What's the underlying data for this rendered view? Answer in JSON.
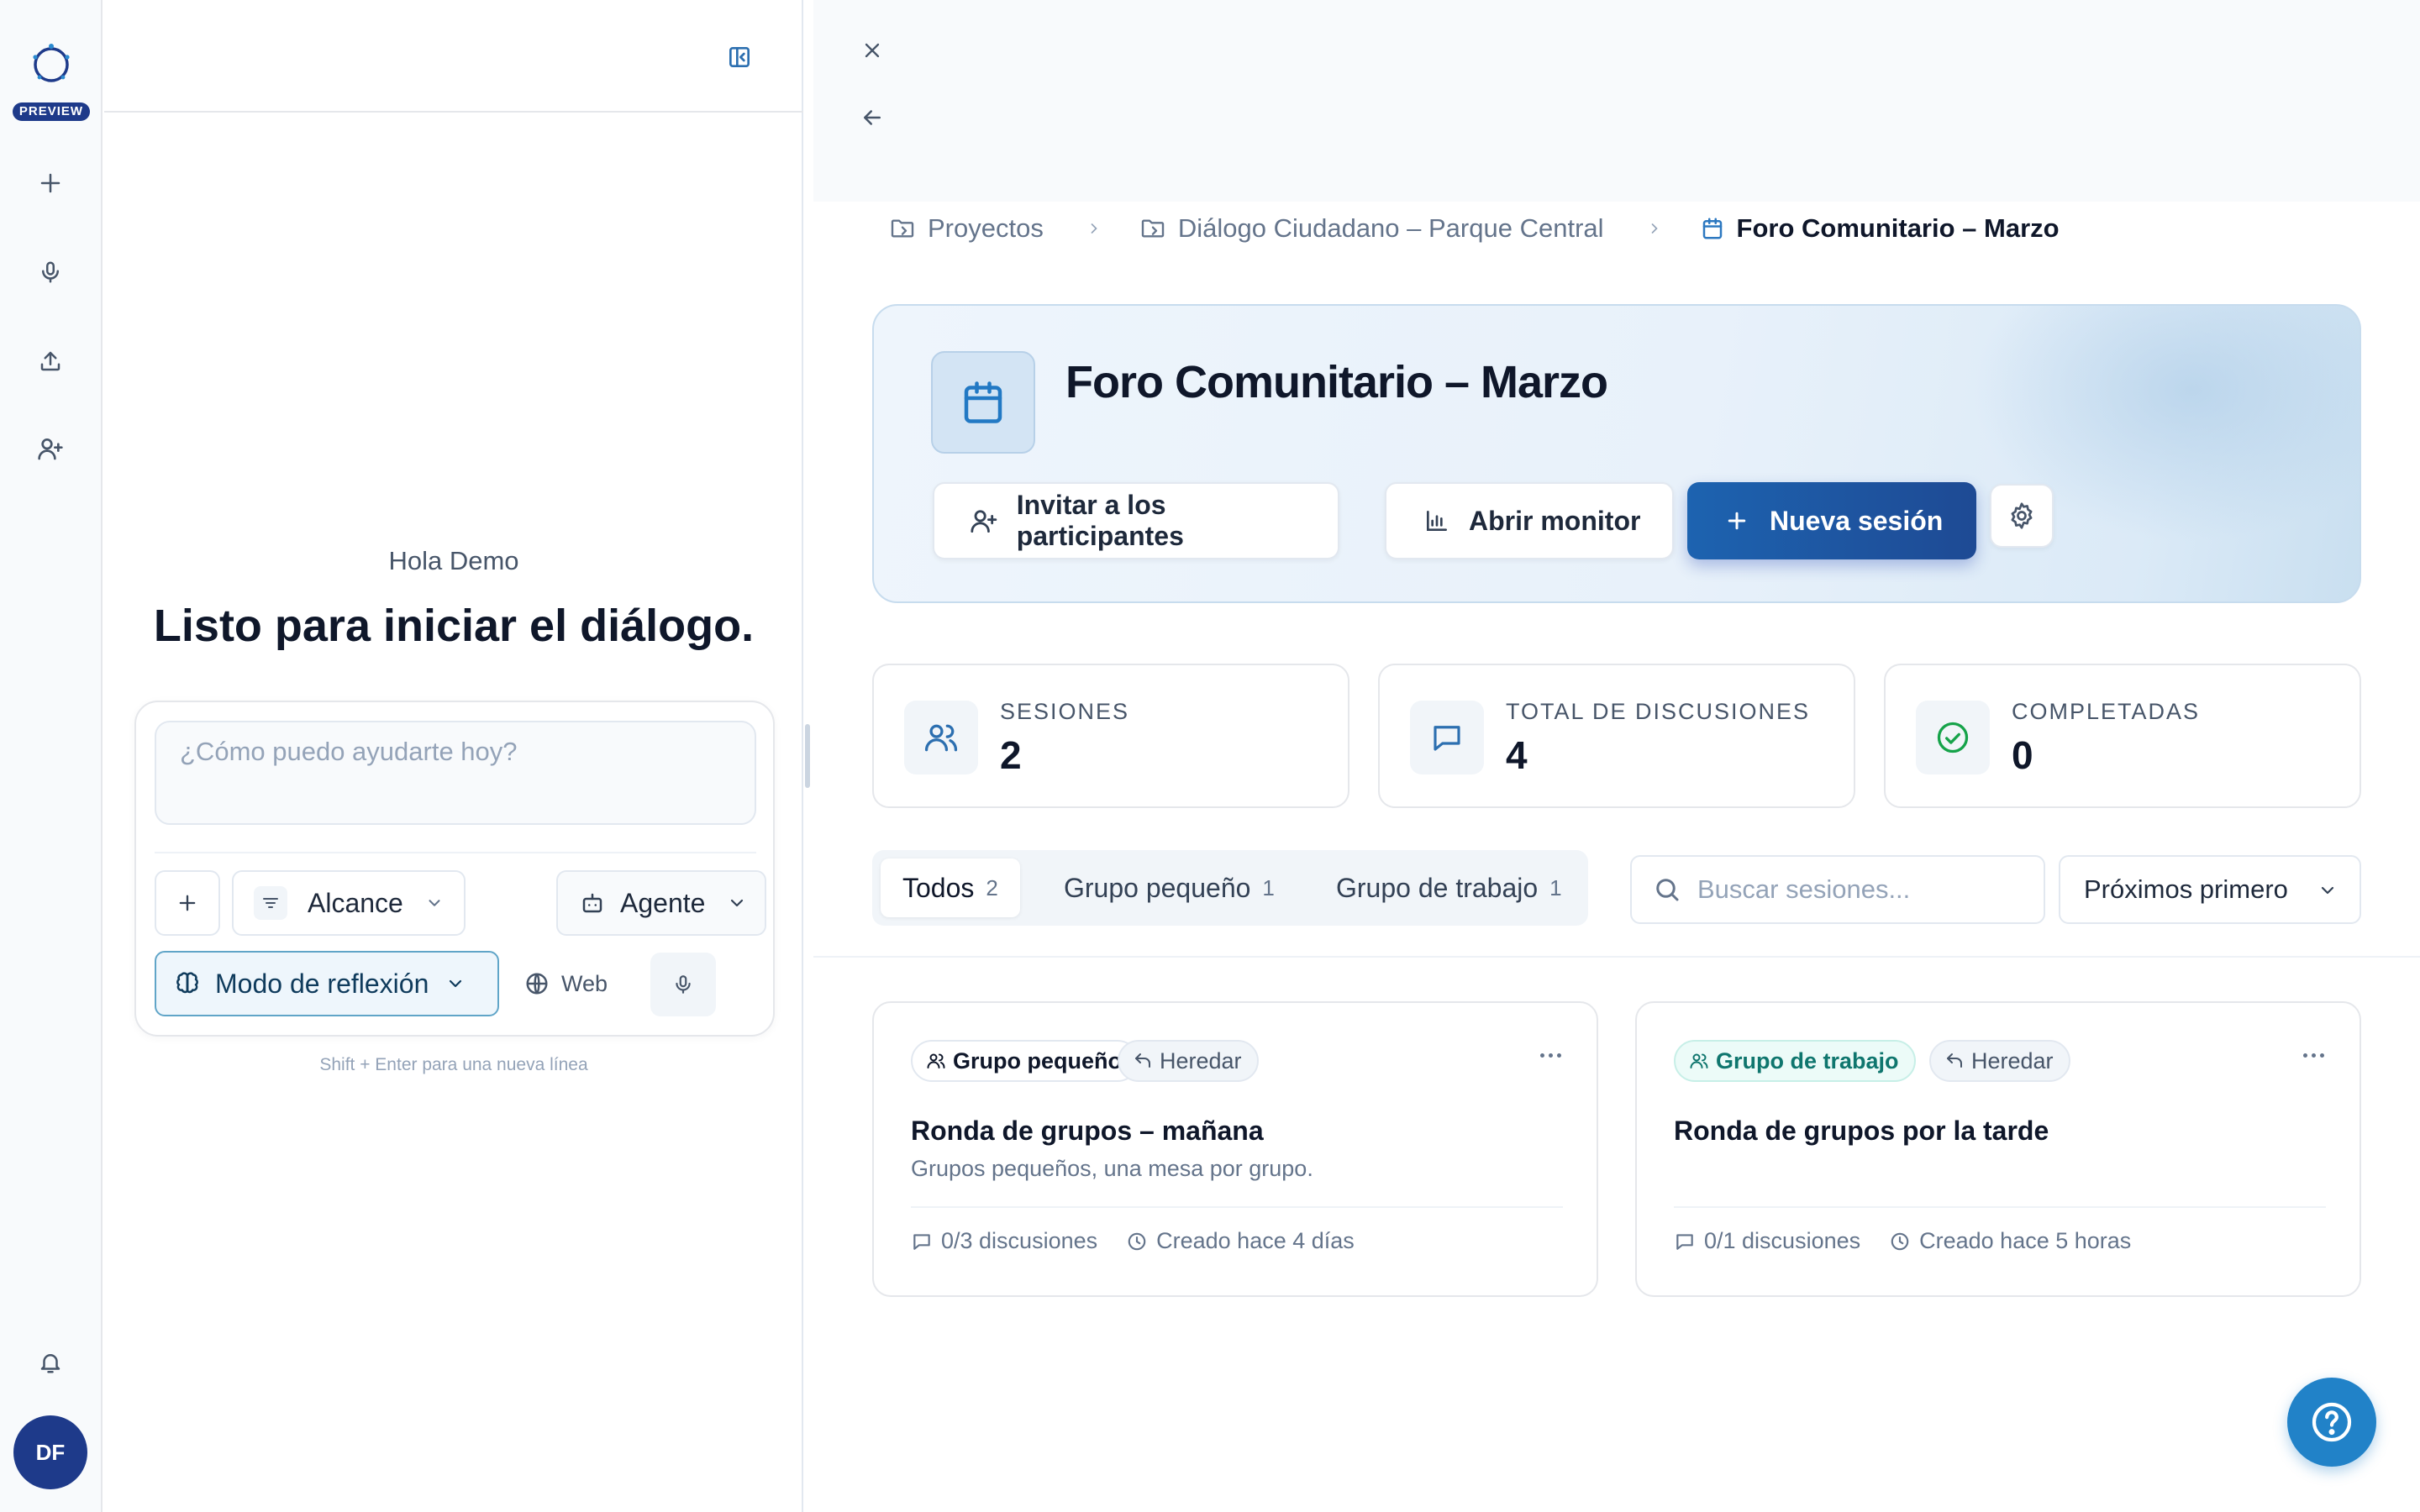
{
  "rail": {
    "badge": "PREVIEW",
    "avatar_initials": "DF",
    "items": [
      {
        "icon": "plus-icon",
        "name": "new-chat"
      },
      {
        "icon": "microphone-icon",
        "name": "record"
      },
      {
        "icon": "upload-icon",
        "name": "upload"
      },
      {
        "icon": "user-plus-icon",
        "name": "invite"
      }
    ],
    "bell_icon": "bell-icon"
  },
  "chat": {
    "greeting": "Hola Demo",
    "title": "Listo para iniciar el diálogo.",
    "input_placeholder": "¿Cómo puedo ayudarte hoy?",
    "scope_label": "Alcance",
    "agent_label": "Agente",
    "thinking_label": "Modo de reflexión",
    "web_label": "Web",
    "hint": "Shift + Enter para una nueva línea"
  },
  "breadcrumb": {
    "items": [
      "Proyectos",
      "Diálogo Ciudadano – Parque Central",
      "Foro Comunitario – Marzo"
    ]
  },
  "hero": {
    "title": "Foro Comunitario – Marzo",
    "invite_label": "Invitar a los participantes",
    "monitor_label": "Abrir monitor",
    "new_session_label": "Nueva sesión"
  },
  "stats": [
    {
      "label": "SESIONES",
      "value": "2",
      "icon": "users-icon"
    },
    {
      "label": "TOTAL DE DISCUSIONES",
      "value": "4",
      "icon": "message-icon"
    },
    {
      "label": "COMPLETADAS",
      "value": "0",
      "icon": "check-circle-icon"
    }
  ],
  "filters": {
    "tabs": [
      {
        "label": "Todos",
        "count": "2"
      },
      {
        "label": "Grupo pequeño",
        "count": "1"
      },
      {
        "label": "Grupo de trabajo",
        "count": "1"
      }
    ],
    "search_placeholder": "Buscar sesiones...",
    "sort_label": "Próximos primero"
  },
  "sessions": [
    {
      "type": "Grupo pequeño",
      "inherit": "Heredar",
      "title": "Ronda de grupos – mañana",
      "description": "Grupos pequeños, una mesa por grupo.",
      "discussions": "0/3 discusiones",
      "created": "Creado hace 4 días"
    },
    {
      "type": "Grupo de trabajo",
      "inherit": "Heredar",
      "title": "Ronda de grupos por la tarde",
      "description": "",
      "discussions": "0/1 discusiones",
      "created": "Creado hace 5 horas"
    }
  ],
  "colors": {
    "brand": "#1e3a8a",
    "primary_button": "#1e55a0",
    "accent_teal": "#0f766e",
    "help_button": "#2182c8"
  }
}
